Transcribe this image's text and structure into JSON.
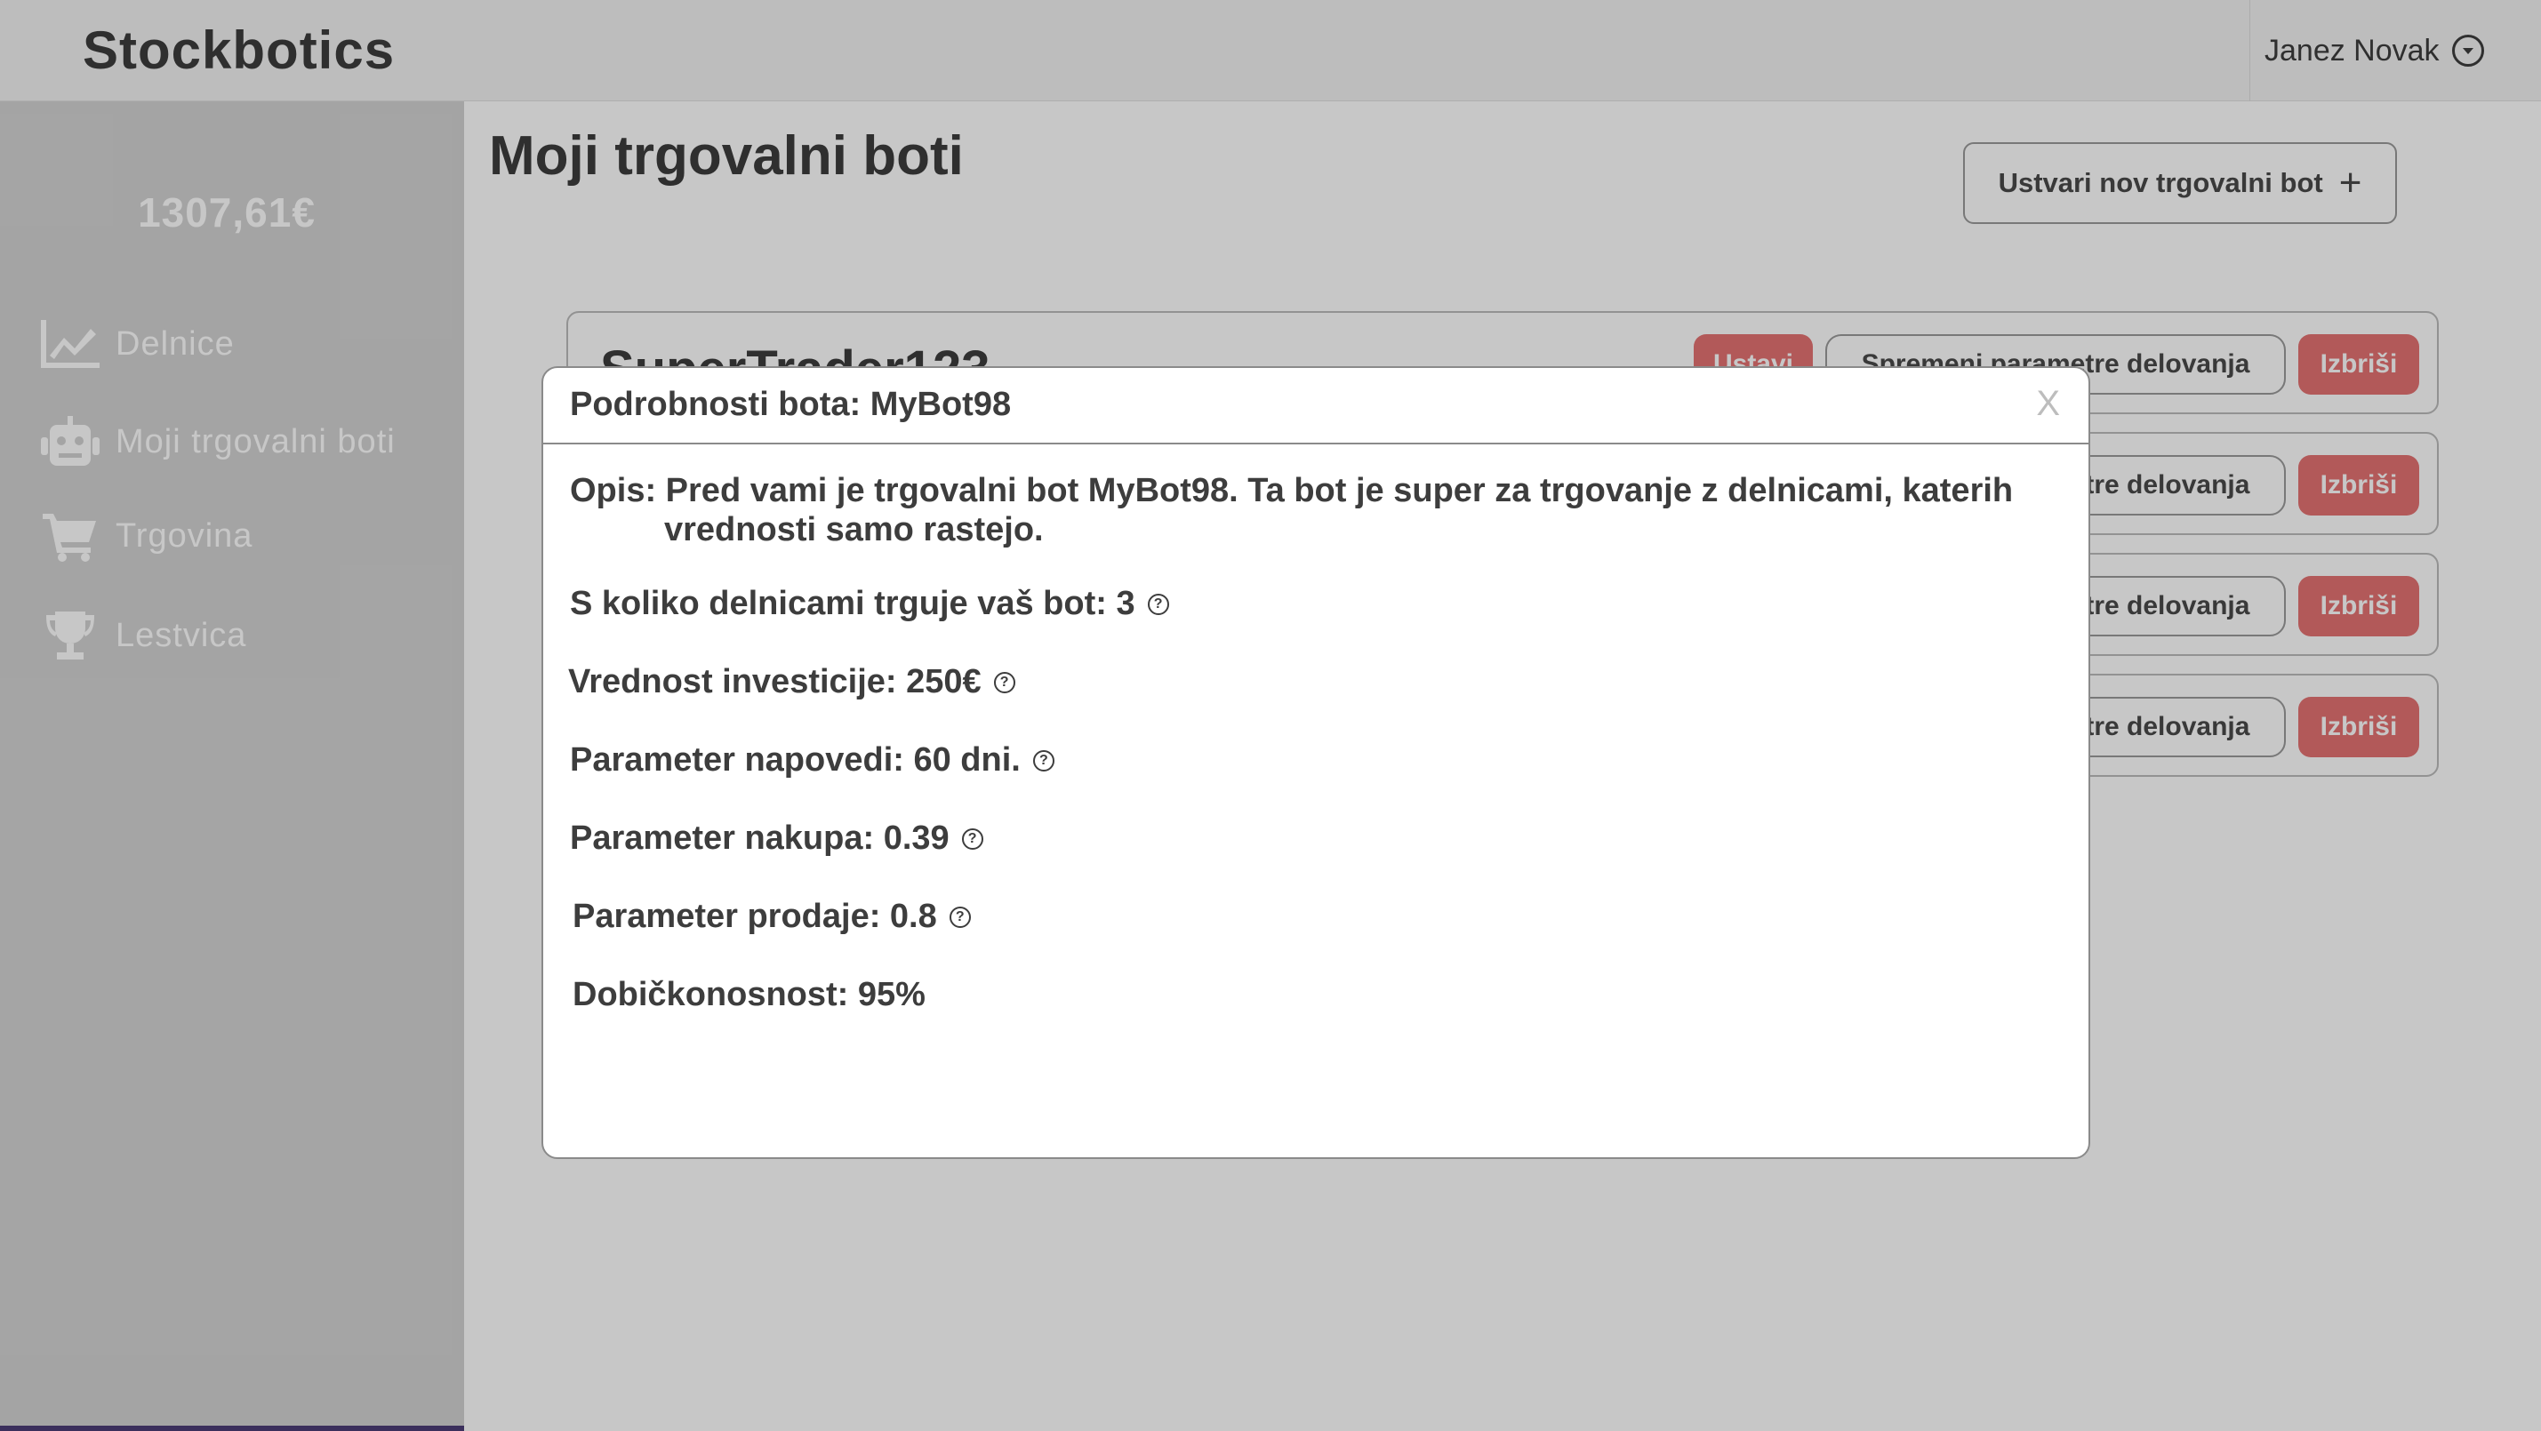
{
  "app": {
    "brand": "Stockbotics"
  },
  "user": {
    "name": "Janez Novak"
  },
  "sidebar": {
    "balance": "1307,61€",
    "items": [
      {
        "label": "Delnice",
        "icon": "chart-line-icon"
      },
      {
        "label": "Moji trgovalni boti",
        "icon": "robot-icon"
      },
      {
        "label": "Trgovina",
        "icon": "cart-icon"
      },
      {
        "label": "Lestvica",
        "icon": "trophy-icon"
      }
    ]
  },
  "main": {
    "title": "Moji trgovalni boti",
    "create_button": "Ustvari nov trgovalni bot",
    "create_icon": "+",
    "bots": [
      {
        "name": "SuperTrader123",
        "stop": "Ustavi",
        "params": "Spremeni parametre delovanja",
        "delete": "Izbriši"
      },
      {
        "name": "",
        "stop": "",
        "params": "Spremeni parametre delovanja",
        "delete": "Izbriši"
      },
      {
        "name": "",
        "stop": "",
        "params": "Spremeni parametre delovanja",
        "delete": "Izbriši"
      },
      {
        "name": "",
        "stop": "",
        "params": "Spremeni parametre delovanja",
        "delete": "Izbriši"
      }
    ]
  },
  "modal": {
    "title": "Podrobnosti bota: MyBot98",
    "close": "X",
    "description": "Opis: Pred vami je trgovalni bot MyBot98. Ta bot je super za trgovanje z delnicami, katerih vrednosti samo rastejo.",
    "stocks_count": "S koliko delnicami trguje vaš bot: 3",
    "investment": "Vrednost investicije: 250€",
    "forecast": "Parameter napovedi: 60 dni.",
    "buy": "Parameter nakupa: 0.39",
    "sell": "Parameter prodaje: 0.8",
    "profit": "Dobičkonosnost: 95%",
    "help_glyph": "?"
  }
}
